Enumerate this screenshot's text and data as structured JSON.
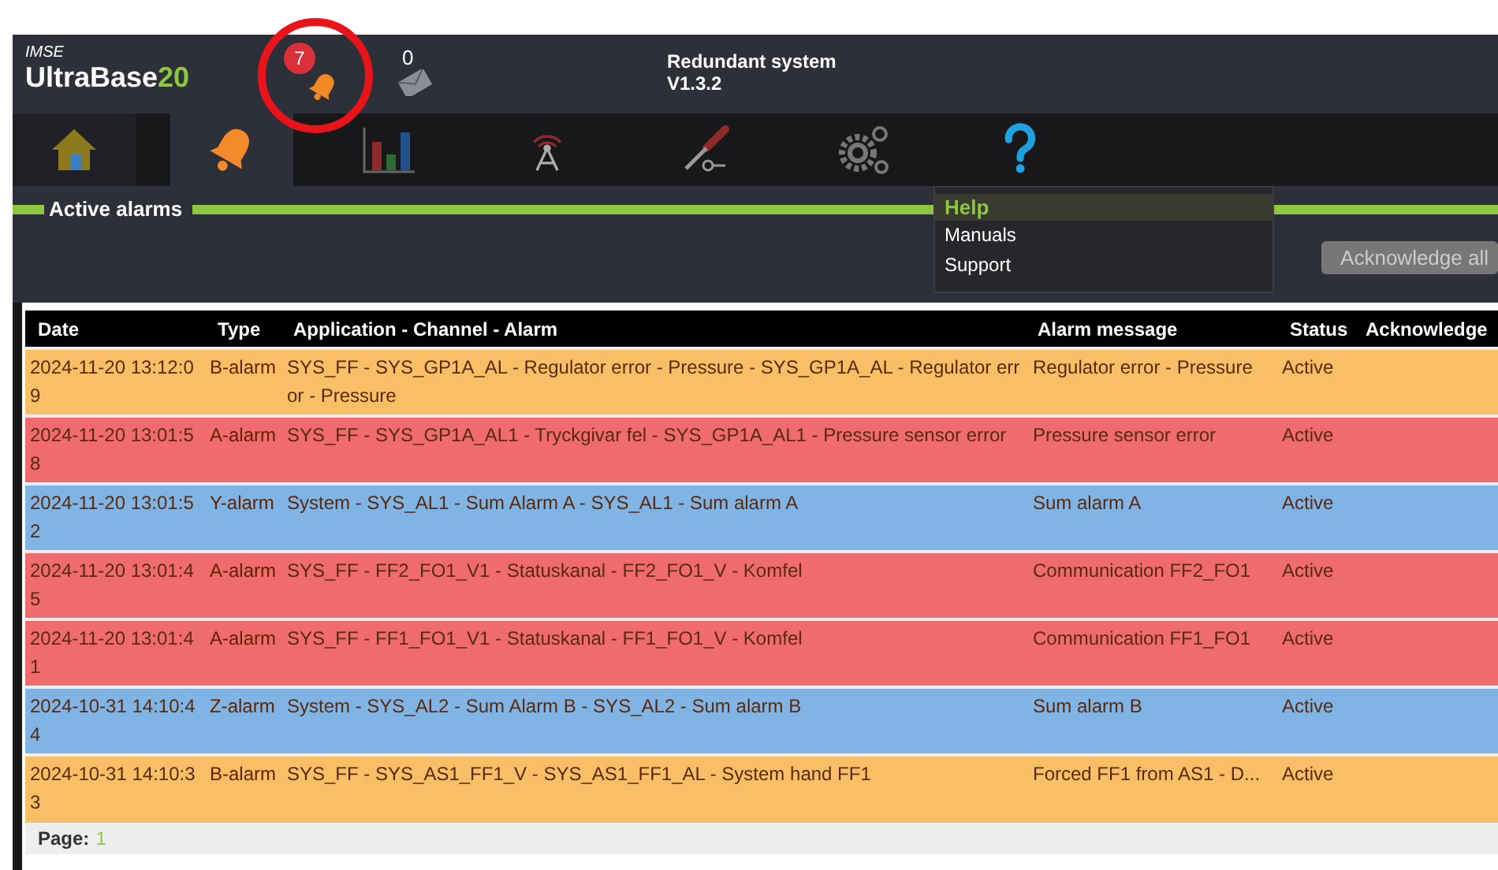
{
  "header": {
    "brand": "IMSE",
    "product": "UltraBase",
    "product_number": "20",
    "alarm_count": "7",
    "message_count": "0",
    "system_name": "Redundant system",
    "version": "V1.3.2"
  },
  "nav": {
    "tabs": [
      {
        "kind": "home",
        "selected": false
      },
      {
        "kind": "alarms",
        "selected": true
      },
      {
        "kind": "charts",
        "selected": false
      },
      {
        "kind": "communication",
        "selected": false
      },
      {
        "kind": "tools",
        "selected": false
      },
      {
        "kind": "settings",
        "selected": false
      },
      {
        "kind": "help",
        "selected": false
      }
    ]
  },
  "help_menu": {
    "title": "Help",
    "items": [
      "Manuals",
      "Support"
    ]
  },
  "section": {
    "title": "Active alarms"
  },
  "acknowledge_all": {
    "label": "Acknowledge all",
    "disabled": true
  },
  "table": {
    "columns": [
      "Date",
      "Type",
      "Application - Channel - Alarm",
      "Alarm message",
      "Status",
      "Acknowledge"
    ],
    "rows": [
      {
        "date": "2024-11-20 13:12:09",
        "type": "B-alarm",
        "alarm": "SYS_FF - SYS_GP1A_AL - Regulator error - Pressure - SYS_GP1A_AL - Regulator error - Pressure",
        "message": "Regulator error - Pressure",
        "status": "Active",
        "color": "#f9bf66"
      },
      {
        "date": "2024-11-20 13:01:58",
        "type": "A-alarm",
        "alarm": "SYS_FF - SYS_GP1A_AL1 - Tryckgivar fel - SYS_GP1A_AL1 - Pressure sensor error",
        "message": "Pressure sensor error",
        "status": "Active",
        "color": "#ef6b6e"
      },
      {
        "date": "2024-11-20 13:01:52",
        "type": "Y-alarm",
        "alarm": "System - SYS_AL1 - Sum Alarm A - SYS_AL1 - Sum alarm A",
        "message": "Sum alarm A",
        "status": "Active",
        "color": "#7fb4e4"
      },
      {
        "date": "2024-11-20 13:01:45",
        "type": "A-alarm",
        "alarm": "SYS_FF - FF2_FO1_V1 - Statuskanal - FF2_FO1_V - Komfel",
        "message": "Communication FF2_FO1",
        "status": "Active",
        "color": "#ef6b6e"
      },
      {
        "date": "2024-11-20 13:01:41",
        "type": "A-alarm",
        "alarm": "SYS_FF - FF1_FO1_V1 - Statuskanal - FF1_FO1_V - Komfel",
        "message": "Communication FF1_FO1",
        "status": "Active",
        "color": "#ef6b6e"
      },
      {
        "date": "2024-10-31 14:10:44",
        "type": "Z-alarm",
        "alarm": "System - SYS_AL2 - Sum Alarm B - SYS_AL2 - Sum alarm B",
        "message": "Sum alarm B",
        "status": "Active",
        "color": "#7fb4e4"
      },
      {
        "date": "2024-10-31 14:10:33",
        "type": "B-alarm",
        "alarm": "SYS_FF - SYS_AS1_FF1_V - SYS_AS1_FF1_AL - System hand FF1",
        "message": "Forced FF1 from AS1 - D...",
        "status": "Active",
        "color": "#f9bf66"
      }
    ]
  },
  "footer": {
    "label": "Page:",
    "page": "1"
  }
}
